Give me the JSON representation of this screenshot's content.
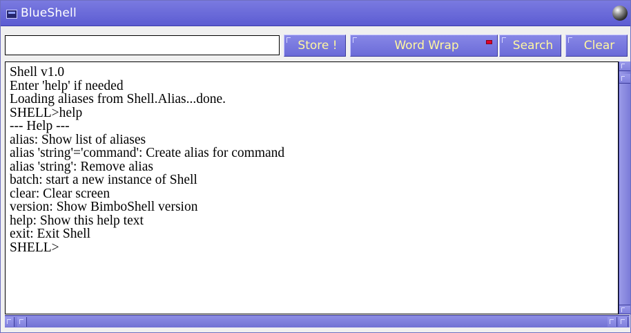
{
  "window": {
    "title": "BlueShell"
  },
  "toolbar": {
    "command_value": "",
    "store_label": "Store !",
    "wordwrap_label": "Word Wrap",
    "search_label": "Search",
    "clear_label": "Clear",
    "wordwrap_indicator_color": "#e0002a"
  },
  "console": {
    "lines": [
      "Shell v1.0",
      "Enter 'help' if needed",
      "Loading aliases from Shell.Alias...done.",
      "SHELL>help",
      "--- Help ---",
      "alias: Show list of aliases",
      "alias 'string'='command': Create alias for command",
      "alias 'string': Remove alias",
      "batch: start a new instance of Shell",
      "clear: Clear screen",
      "version: Show BimboShell version",
      "help: Show this help text",
      "exit: Exit Shell",
      "SHELL>"
    ]
  },
  "colors": {
    "accent": "#6b6bd8",
    "button_text": "#fff7a0"
  }
}
